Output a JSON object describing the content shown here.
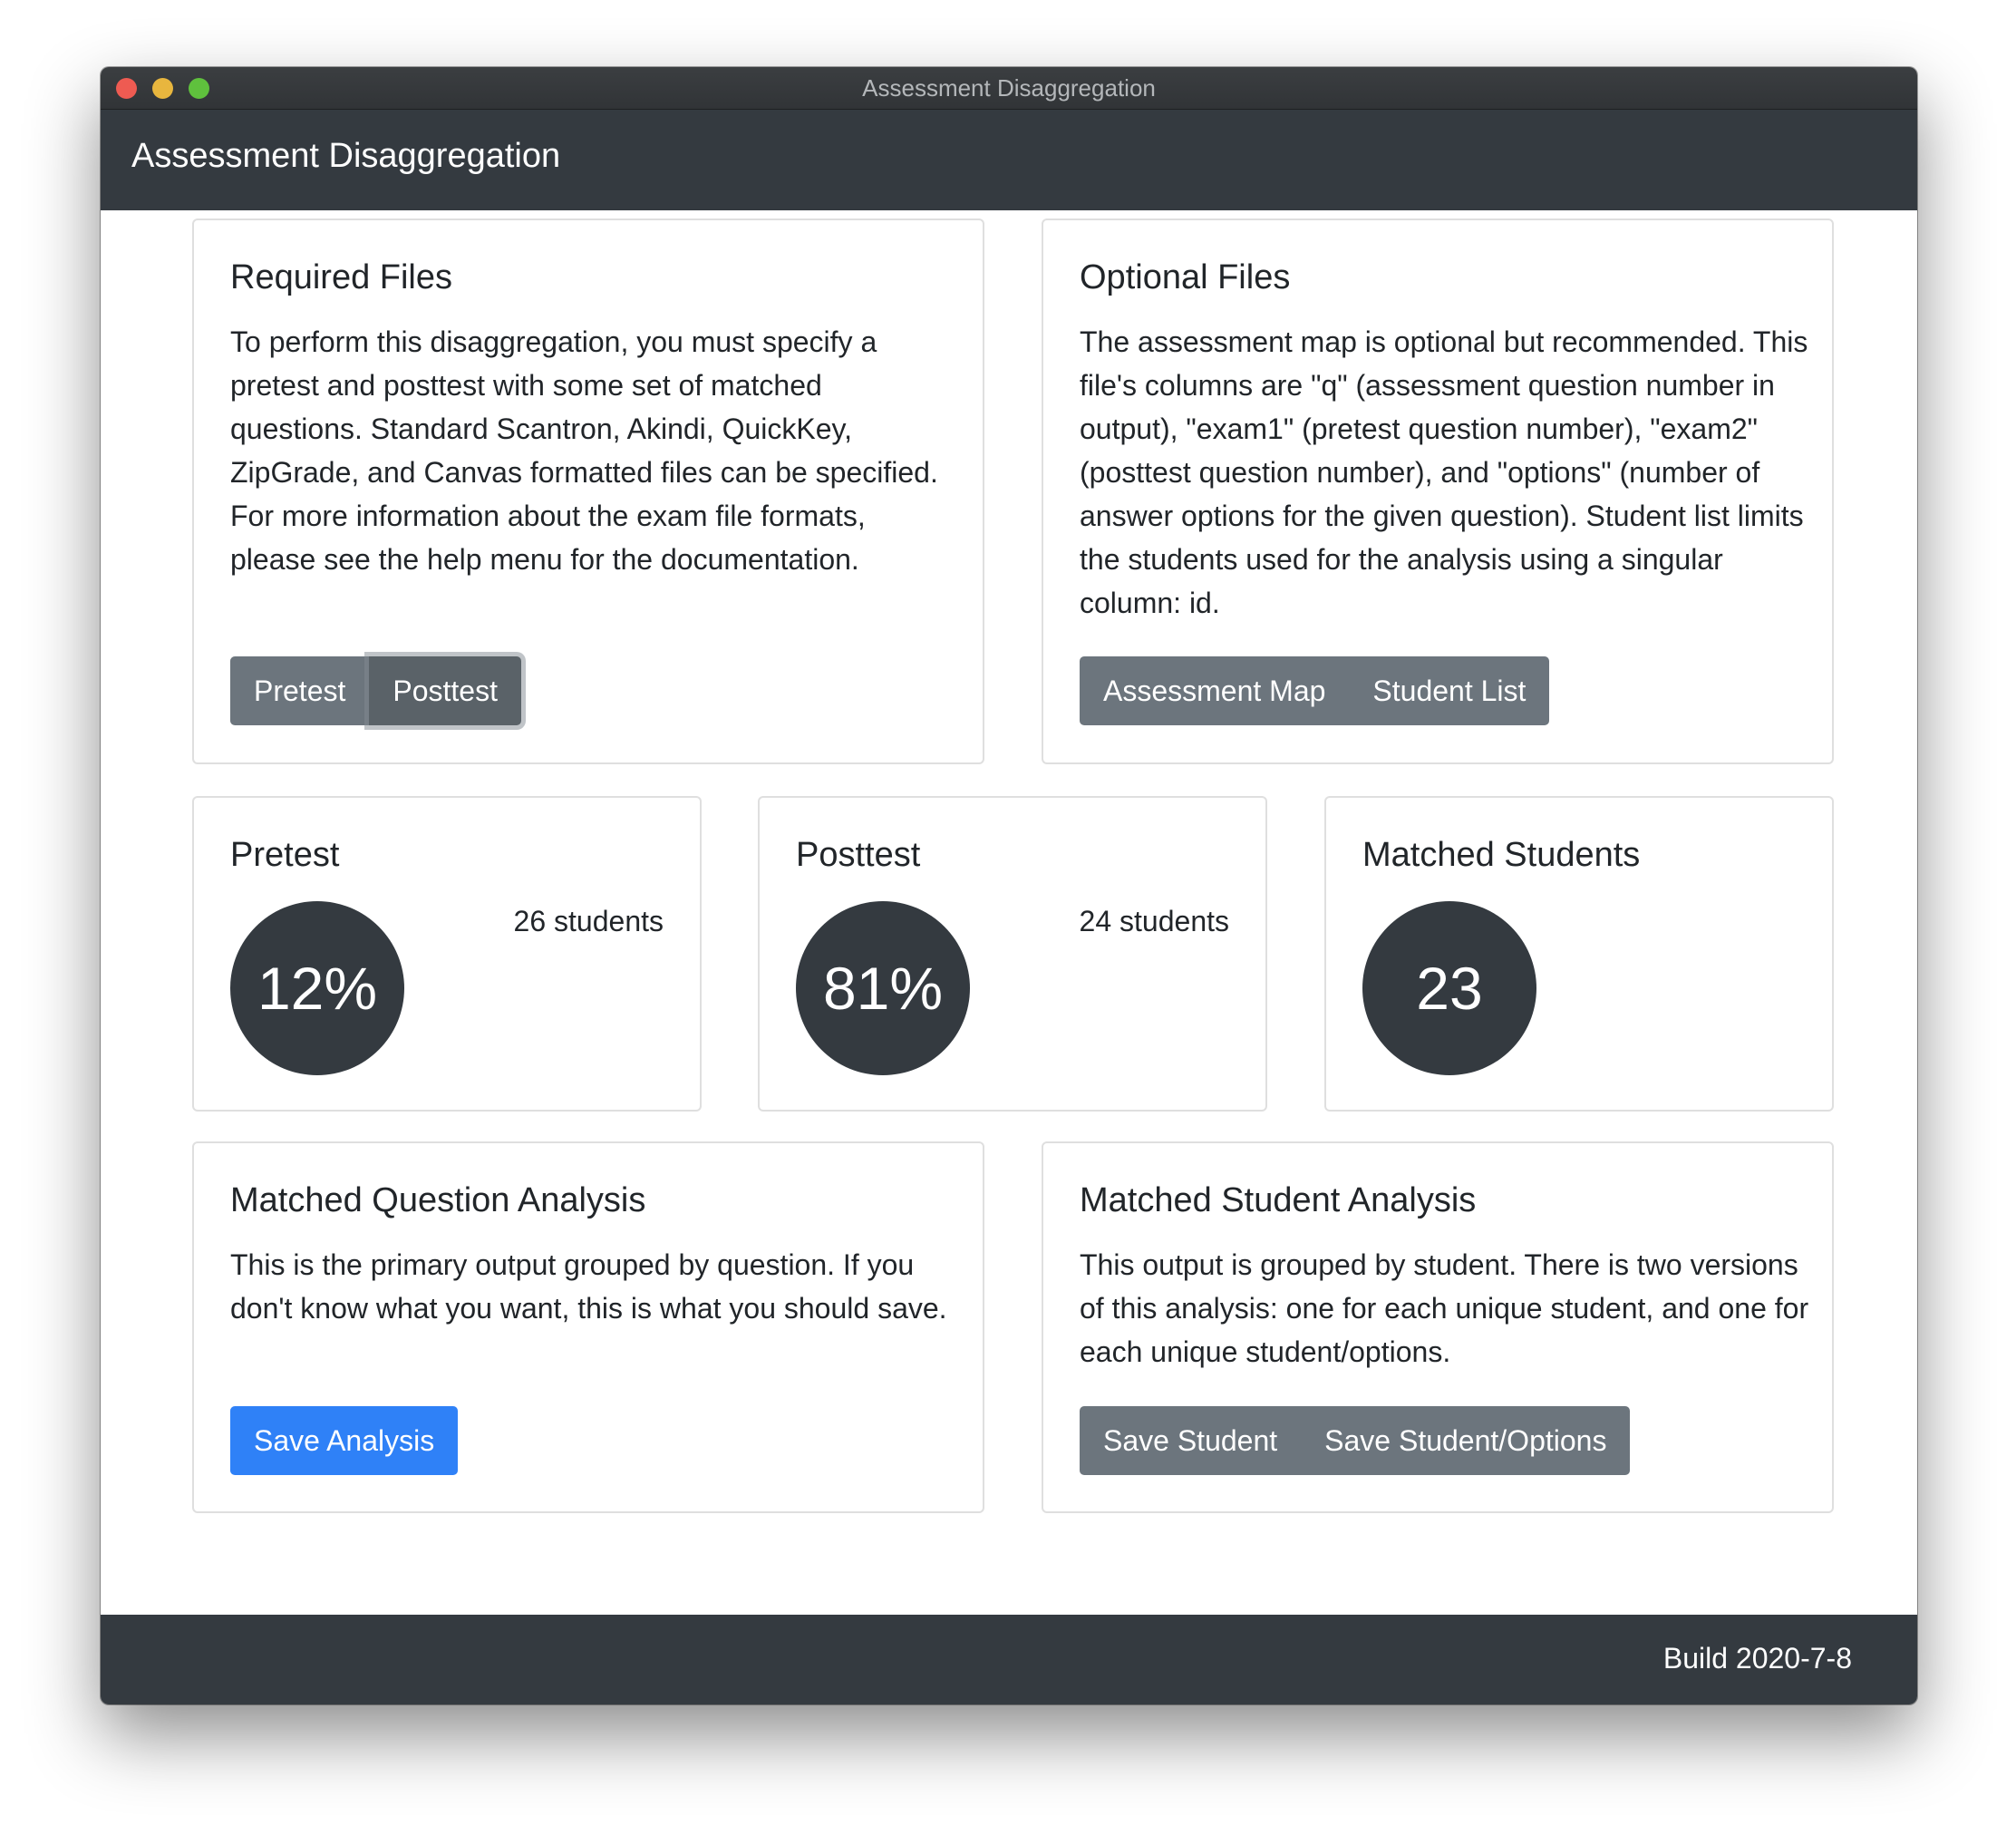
{
  "window": {
    "title": "Assessment Disaggregation"
  },
  "navbar": {
    "brand": "Assessment Disaggregation"
  },
  "required_files": {
    "title": "Required Files",
    "text": "To perform this disaggregation, you must specify a pretest and posttest with some set of matched questions. Standard Scantron, Akindi, QuickKey, ZipGrade, and Canvas formatted files can be specified. For more information about the exam file formats, please see the help menu for the documentation.",
    "buttons": [
      "Pretest",
      "Posttest"
    ]
  },
  "optional_files": {
    "title": "Optional Files",
    "text": "The assessment map is optional but recommended. This file's columns are \"q\" (assessment question number in output), \"exam1\" (pretest question number), \"exam2\" (posttest question number), and \"options\" (number of answer options for the given question). Student list limits the students used for the analysis using a singular column: id.",
    "buttons": [
      "Assessment Map",
      "Student List"
    ]
  },
  "pretest": {
    "title": "Pretest",
    "value": "12%",
    "students": "26 students"
  },
  "posttest": {
    "title": "Posttest",
    "value": "81%",
    "students": "24 students"
  },
  "matched_students": {
    "title": "Matched Students",
    "value": "23"
  },
  "question_analysis": {
    "title": "Matched Question Analysis",
    "text": "This is the primary output grouped by question. If you don't know what you want, this is what you should save.",
    "button": "Save Analysis"
  },
  "student_analysis": {
    "title": "Matched Student Analysis",
    "text": "This output is grouped by student. There is two versions of this analysis: one for each unique student, and one for each unique student/options.",
    "buttons": [
      "Save Student",
      "Save Student/Options"
    ]
  },
  "footer": {
    "build": "Build 2020-7-8"
  },
  "colors": {
    "navbar": "#343a40",
    "secondary_button": "#6c757d",
    "primary_button": "#2f81f7"
  }
}
